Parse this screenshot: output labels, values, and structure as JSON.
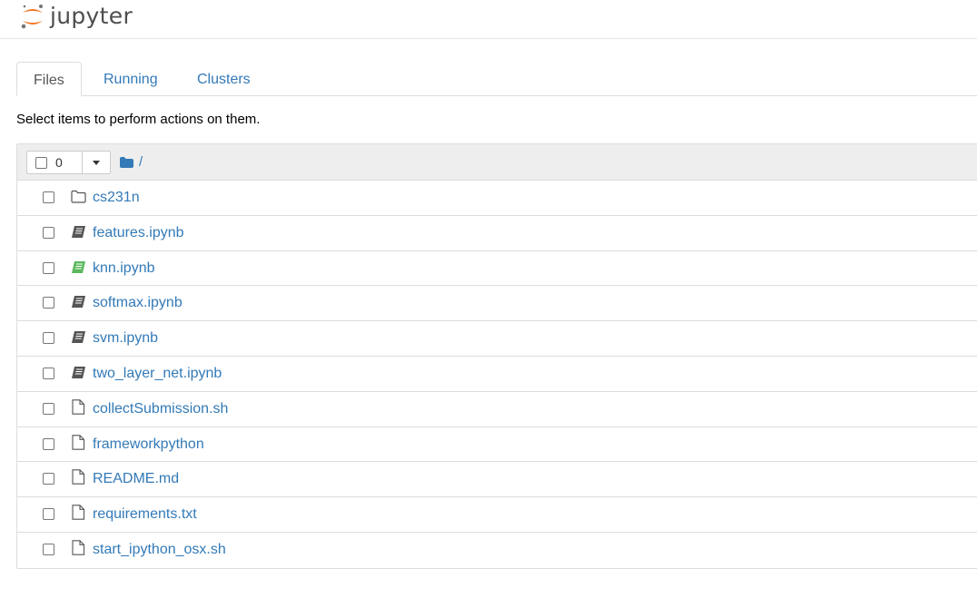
{
  "app": {
    "logo_text": "jupyter",
    "logo_colors": {
      "orange": "#f37726",
      "gray": "#767677"
    }
  },
  "tabs": [
    {
      "label": "Files",
      "active": true
    },
    {
      "label": "Running",
      "active": false
    },
    {
      "label": "Clusters",
      "active": false
    }
  ],
  "hint_text": "Select items to perform actions on them.",
  "toolbar": {
    "selected_count": "0",
    "breadcrumb_path": "/"
  },
  "files": [
    {
      "name": "cs231n",
      "type": "folder",
      "icon": "folder-icon"
    },
    {
      "name": "features.ipynb",
      "type": "notebook",
      "icon": "notebook-icon",
      "running": false
    },
    {
      "name": "knn.ipynb",
      "type": "notebook",
      "icon": "notebook-icon",
      "running": true
    },
    {
      "name": "softmax.ipynb",
      "type": "notebook",
      "icon": "notebook-icon",
      "running": false
    },
    {
      "name": "svm.ipynb",
      "type": "notebook",
      "icon": "notebook-icon",
      "running": false
    },
    {
      "name": "two_layer_net.ipynb",
      "type": "notebook",
      "icon": "notebook-icon",
      "running": false
    },
    {
      "name": "collectSubmission.sh",
      "type": "file",
      "icon": "file-icon"
    },
    {
      "name": "frameworkpython",
      "type": "file",
      "icon": "file-icon"
    },
    {
      "name": "README.md",
      "type": "file",
      "icon": "file-icon"
    },
    {
      "name": "requirements.txt",
      "type": "file",
      "icon": "file-icon"
    },
    {
      "name": "start_ipython_osx.sh",
      "type": "file",
      "icon": "file-icon"
    }
  ],
  "colors": {
    "link": "#337ab7",
    "notebook_idle": "#555555",
    "notebook_running": "#5cb85c",
    "folder_icon": "#337ab7"
  }
}
